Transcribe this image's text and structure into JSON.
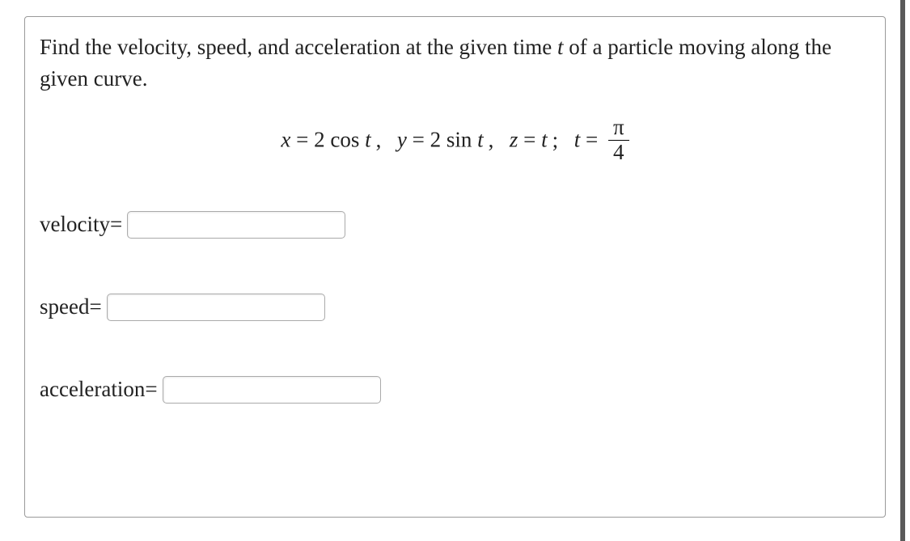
{
  "problem": {
    "prompt_line1": "Find the velocity, speed, and acceleration at the given time ",
    "prompt_var": "t",
    "prompt_line2": " of a particle moving along the given curve.",
    "equation": {
      "x_lhs": "x",
      "x_rhs": "2 cos t",
      "y_lhs": "y",
      "y_rhs": "2 sin t",
      "z_lhs": "z",
      "z_rhs": "t",
      "t_lhs": "t",
      "t_frac_num": "π",
      "t_frac_den": "4"
    },
    "answers": {
      "velocity_label": "velocity=",
      "velocity_value": "",
      "speed_label": "speed=",
      "speed_value": "",
      "acceleration_label": "acceleration=",
      "acceleration_value": ""
    }
  }
}
